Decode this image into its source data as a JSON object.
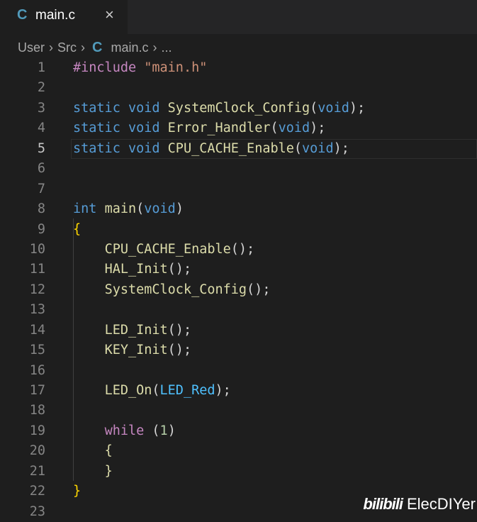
{
  "tab": {
    "icon": "C",
    "label": "main.c",
    "close": "×"
  },
  "breadcrumb": {
    "items": [
      "User",
      "Src"
    ],
    "file_icon": "C",
    "file": "main.c",
    "more": "...",
    "separator": "›"
  },
  "editor": {
    "current_line": 5,
    "lines": [
      {
        "n": "1",
        "t": [
          [
            "ctl",
            "#include"
          ],
          [
            "p",
            " "
          ],
          [
            "str",
            "\"main.h\""
          ]
        ]
      },
      {
        "n": "2",
        "t": []
      },
      {
        "n": "3",
        "t": [
          [
            "kw",
            "static"
          ],
          [
            "p",
            " "
          ],
          [
            "kw",
            "void"
          ],
          [
            "p",
            " "
          ],
          [
            "fn",
            "SystemClock_Config"
          ],
          [
            "p",
            "("
          ],
          [
            "kw",
            "void"
          ],
          [
            "p",
            ");"
          ]
        ]
      },
      {
        "n": "4",
        "t": [
          [
            "kw",
            "static"
          ],
          [
            "p",
            " "
          ],
          [
            "kw",
            "void"
          ],
          [
            "p",
            " "
          ],
          [
            "fn",
            "Error_Handler"
          ],
          [
            "p",
            "("
          ],
          [
            "kw",
            "void"
          ],
          [
            "p",
            ");"
          ]
        ]
      },
      {
        "n": "5",
        "t": [
          [
            "kw",
            "static"
          ],
          [
            "p",
            " "
          ],
          [
            "kw",
            "void"
          ],
          [
            "p",
            " "
          ],
          [
            "fn",
            "CPU_CACHE_Enable"
          ],
          [
            "p",
            "("
          ],
          [
            "kw",
            "void"
          ],
          [
            "p",
            ");"
          ]
        ]
      },
      {
        "n": "6",
        "t": []
      },
      {
        "n": "7",
        "t": []
      },
      {
        "n": "8",
        "t": [
          [
            "kw",
            "int"
          ],
          [
            "p",
            " "
          ],
          [
            "fn",
            "main"
          ],
          [
            "p",
            "("
          ],
          [
            "kw",
            "void"
          ],
          [
            "p",
            ")"
          ]
        ]
      },
      {
        "n": "9",
        "t": [
          [
            "br",
            "{"
          ]
        ]
      },
      {
        "n": "10",
        "t": [
          [
            "p",
            "    "
          ],
          [
            "fn",
            "CPU_CACHE_Enable"
          ],
          [
            "p",
            "();"
          ]
        ]
      },
      {
        "n": "11",
        "t": [
          [
            "p",
            "    "
          ],
          [
            "fn",
            "HAL_Init"
          ],
          [
            "p",
            "();"
          ]
        ]
      },
      {
        "n": "12",
        "t": [
          [
            "p",
            "    "
          ],
          [
            "fn",
            "SystemClock_Config"
          ],
          [
            "p",
            "();"
          ]
        ]
      },
      {
        "n": "13",
        "t": []
      },
      {
        "n": "14",
        "t": [
          [
            "p",
            "    "
          ],
          [
            "fn",
            "LED_Init"
          ],
          [
            "p",
            "();"
          ]
        ]
      },
      {
        "n": "15",
        "t": [
          [
            "p",
            "    "
          ],
          [
            "fn",
            "KEY_Init"
          ],
          [
            "p",
            "();"
          ]
        ]
      },
      {
        "n": "16",
        "t": []
      },
      {
        "n": "17",
        "t": [
          [
            "p",
            "    "
          ],
          [
            "fn",
            "LED_On"
          ],
          [
            "p",
            "("
          ],
          [
            "var",
            "LED_Red"
          ],
          [
            "p",
            ");"
          ]
        ]
      },
      {
        "n": "18",
        "t": []
      },
      {
        "n": "19",
        "t": [
          [
            "p",
            "    "
          ],
          [
            "ctl",
            "while"
          ],
          [
            "p",
            " ("
          ],
          [
            "num",
            "1"
          ],
          [
            "p",
            ")"
          ]
        ]
      },
      {
        "n": "20",
        "t": [
          [
            "p",
            "    "
          ],
          [
            "fn",
            "{"
          ]
        ]
      },
      {
        "n": "21",
        "t": [
          [
            "p",
            "    "
          ],
          [
            "fn",
            "}"
          ]
        ]
      },
      {
        "n": "22",
        "t": [
          [
            "br",
            "}"
          ]
        ]
      },
      {
        "n": "23",
        "t": []
      }
    ]
  },
  "watermark": {
    "logo": "bilibili",
    "author": "ElecDIYer"
  }
}
